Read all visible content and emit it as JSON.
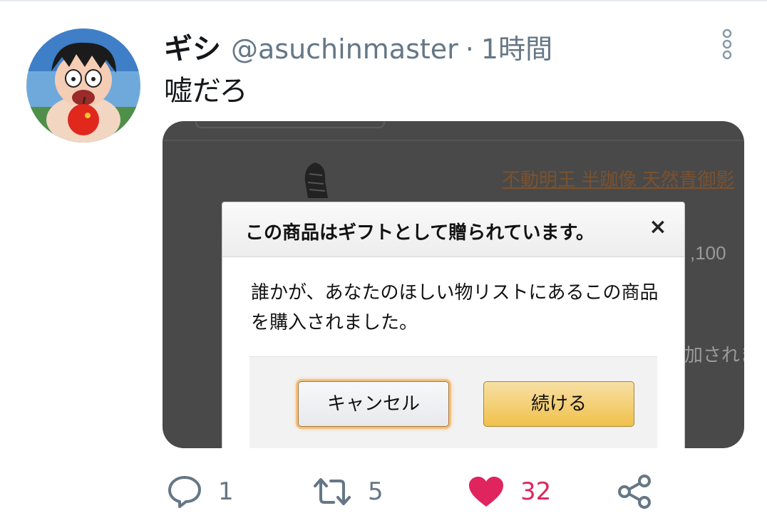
{
  "tweet": {
    "display_name": "ギシ",
    "handle": "@asuchinmaster",
    "separator": "·",
    "time": "1時間",
    "text": "嘘だろ"
  },
  "media": {
    "product_link": "不動明王 半跏像 天然青御影",
    "price": ",100",
    "added_text": "加されま"
  },
  "modal": {
    "title": "この商品はギフトとして贈られています。",
    "close": "×",
    "body": "誰かが、あなたのほしい物リストにあるこの商品を購入されました。",
    "cancel_label": "キャンセル",
    "continue_label": "続ける"
  },
  "actions": {
    "reply_count": "1",
    "retweet_count": "5",
    "like_count": "32"
  },
  "icons": {
    "reply": "reply-icon",
    "retweet": "retweet-icon",
    "like": "heart-icon",
    "share": "share-icon",
    "more": "more-vertical-icon"
  },
  "colors": {
    "like": "#e0245e",
    "secondary_text": "#657786",
    "continue_button": "#f0c14b"
  }
}
